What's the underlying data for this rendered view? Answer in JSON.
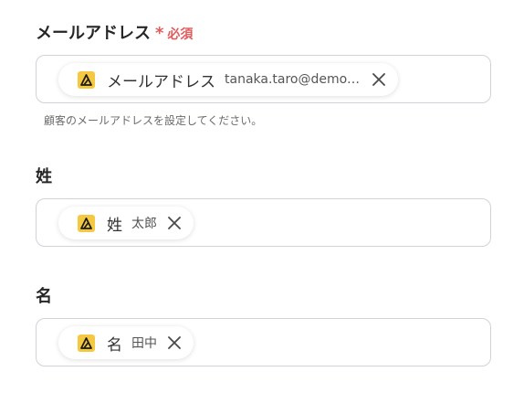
{
  "fields": [
    {
      "label": "メールアドレス",
      "required_mark": "*",
      "required_text": "必須",
      "chip": {
        "name": "メールアドレス",
        "value": "tanaka.taro@demo.com",
        "icon": "app-logo-icon"
      },
      "help": "顧客のメールアドレスを設定してください。"
    },
    {
      "label": "姓",
      "chip": {
        "name": "姓",
        "value": "太郎",
        "icon": "app-logo-icon"
      }
    },
    {
      "label": "名",
      "chip": {
        "name": "名",
        "value": "田中",
        "icon": "app-logo-icon"
      }
    }
  ],
  "colors": {
    "required": "#e25b5b",
    "icon_bg": "#f5c842",
    "border": "#cfd3d8"
  }
}
